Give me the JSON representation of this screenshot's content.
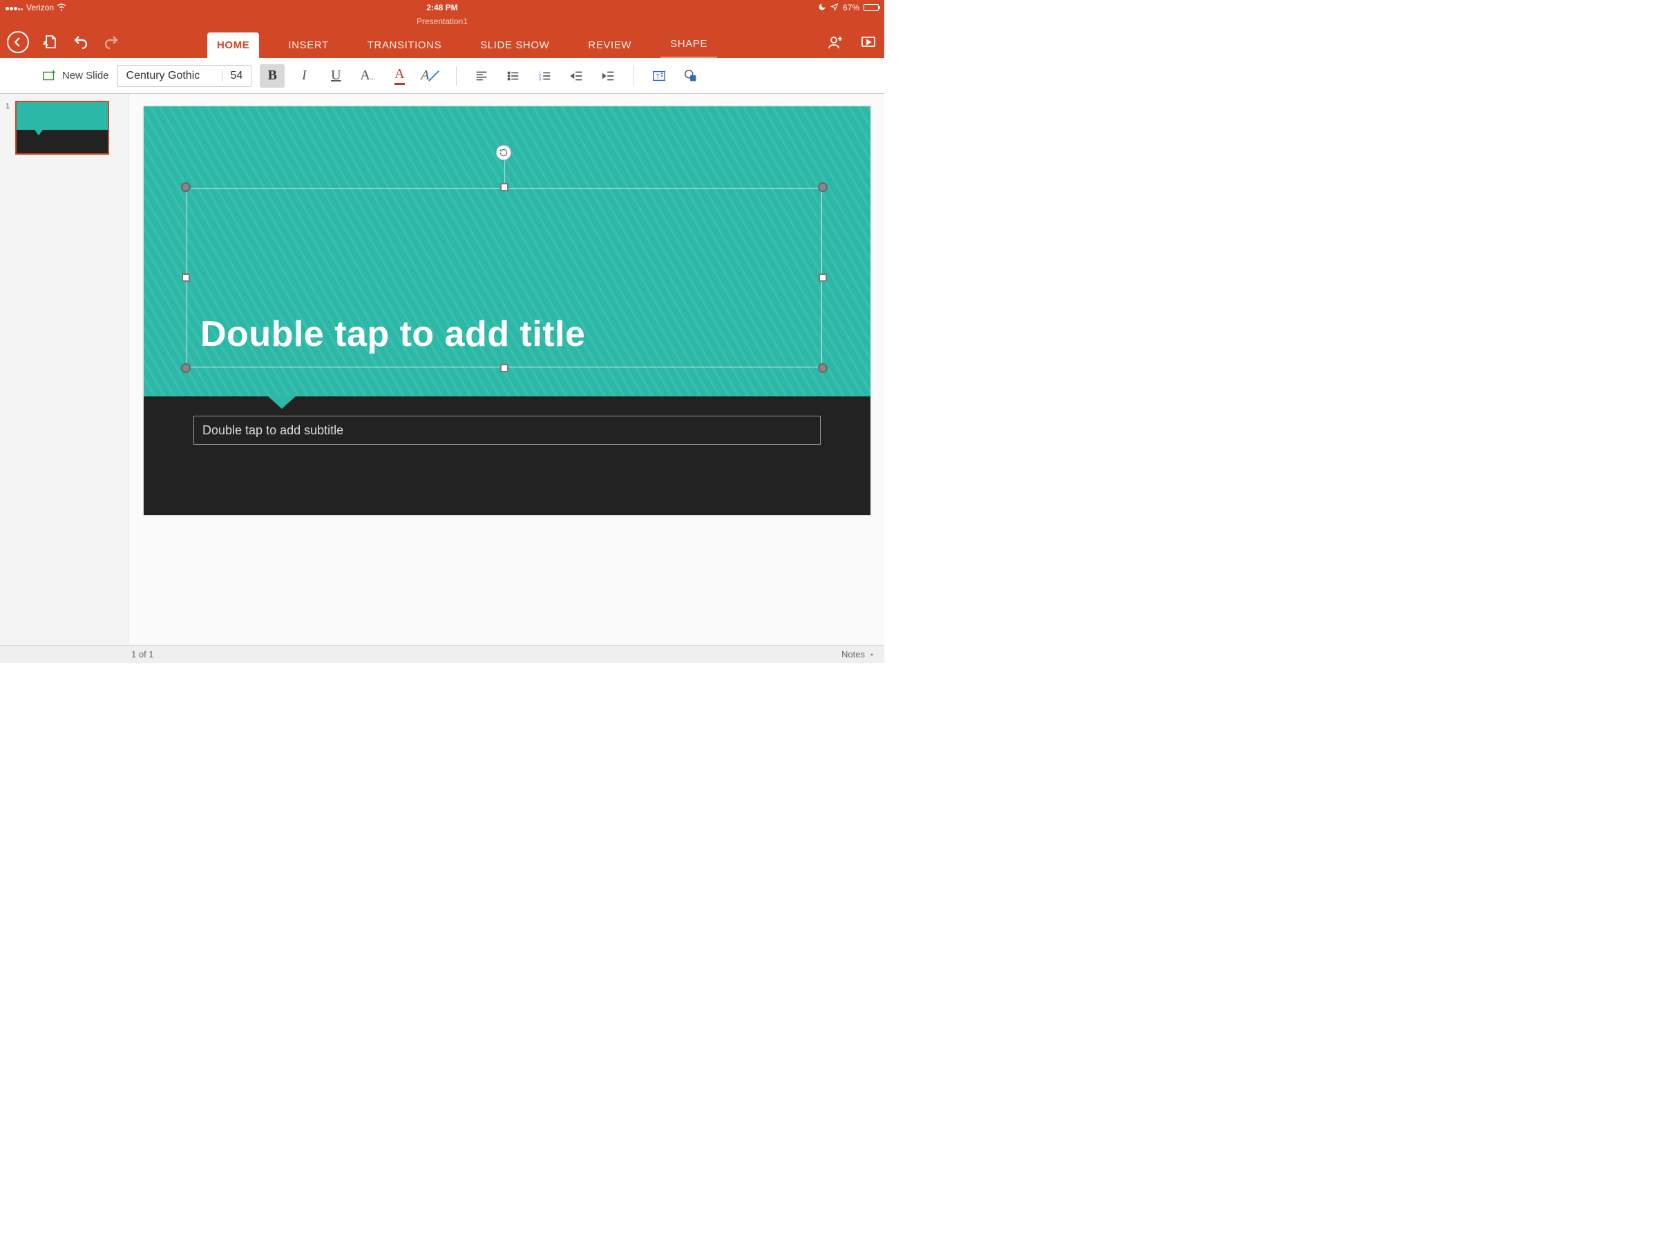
{
  "statusbar": {
    "carrier": "Verizon",
    "time": "2:48 PM",
    "battery_pct": "67%"
  },
  "header": {
    "doc_title": "Presentation1",
    "tabs": {
      "home": "HOME",
      "insert": "INSERT",
      "transitions": "TRANSITIONS",
      "slideshow": "SLIDE SHOW",
      "review": "REVIEW",
      "shape": "SHAPE"
    }
  },
  "ribbon": {
    "new_slide": "New Slide",
    "font_name": "Century Gothic",
    "font_size": "54"
  },
  "thumbnails": {
    "slide1_num": "1"
  },
  "slide": {
    "title_placeholder": "Double tap to add title",
    "subtitle_placeholder": "Double tap to add subtitle"
  },
  "footer": {
    "slide_counter": "1 of 1",
    "notes": "Notes"
  }
}
